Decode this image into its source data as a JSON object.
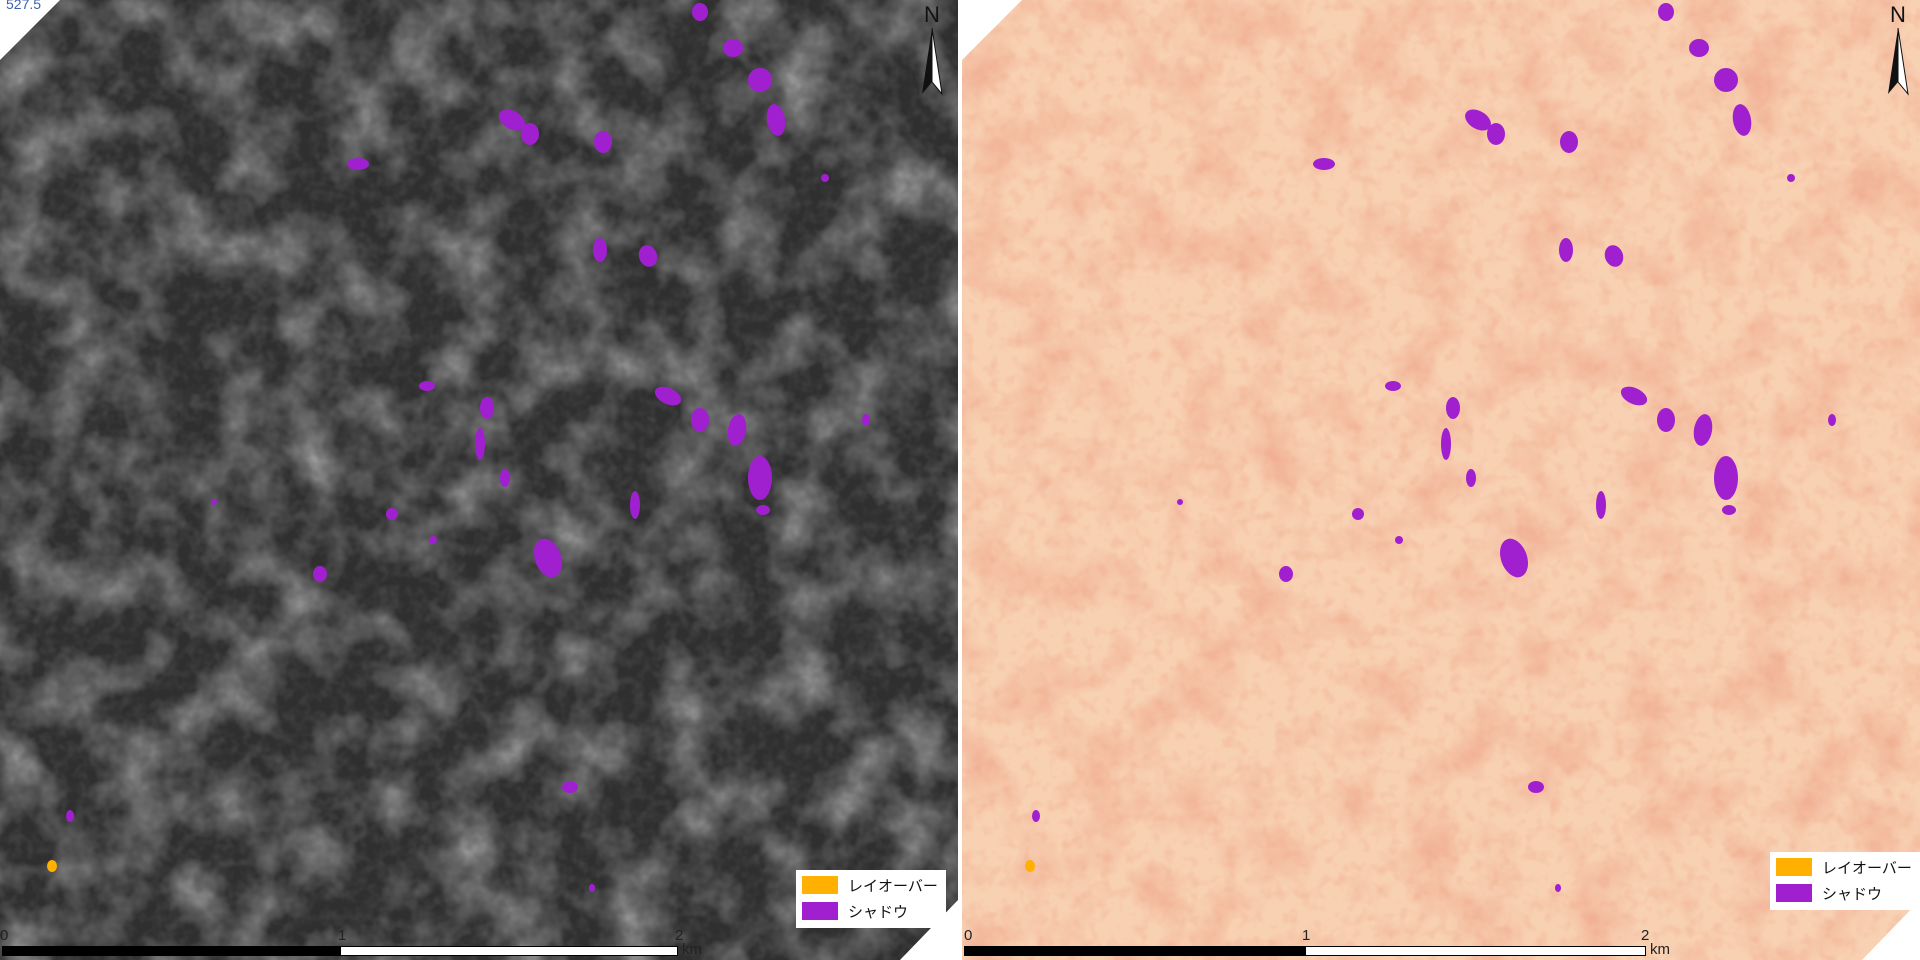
{
  "sheet_label": "527.5",
  "north_label": "N",
  "legend": {
    "items": [
      {
        "label": "レイオーバー",
        "color": "#ffb000"
      },
      {
        "label": "シャドウ",
        "color": "#a020d0"
      }
    ]
  },
  "scalebar": {
    "ticks": [
      "0",
      "1",
      "2"
    ],
    "unit": "km"
  },
  "panels": {
    "left": {
      "base_color": "#2f2f2f",
      "ridge_color": "#9a9a9a"
    },
    "right": {
      "base_color": "#f6c8a8",
      "ridge_color": "#e08060"
    }
  }
}
